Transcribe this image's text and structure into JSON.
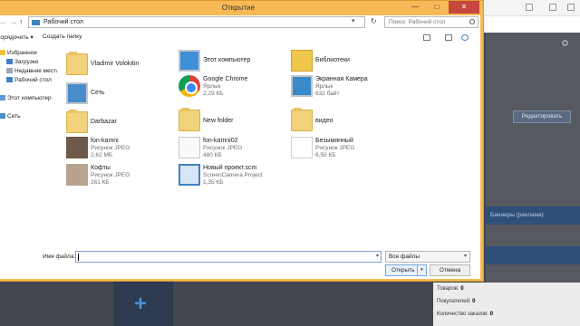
{
  "dialog": {
    "title": "Открытие",
    "close_glyph": "✕",
    "min_glyph": "—",
    "max_glyph": "□"
  },
  "address": {
    "path": "Рабочий стол",
    "search_placeholder": "Поиск: Рабочий стол",
    "refresh_glyph": "↻",
    "back_glyph": "←",
    "forward_glyph": "→",
    "up_glyph": "↑",
    "chevron_glyph": "▾"
  },
  "toolbar": {
    "organize": "Упорядочить ▾",
    "new_folder": "Создать папку"
  },
  "sidebar": {
    "items": [
      {
        "label": "Избранное",
        "icon": "star-icon"
      },
      {
        "label": "Загрузки",
        "icon": "downloads-icon"
      },
      {
        "label": "Недавние места",
        "icon": "recent-icon"
      },
      {
        "label": "Рабочий стол",
        "icon": "desktop-icon"
      },
      {
        "label": "Этот компьютер",
        "icon": "computer-icon"
      },
      {
        "label": "Сеть",
        "icon": "network-icon"
      }
    ]
  },
  "files": [
    {
      "name": "Vladimir Volokitin",
      "sub1": "",
      "sub2": "",
      "icon": "folder-icon"
    },
    {
      "name": "Сеть",
      "sub1": "",
      "sub2": "",
      "icon": "network-icon"
    },
    {
      "name": "Darbazar",
      "sub1": "",
      "sub2": "",
      "icon": "folder-icon"
    },
    {
      "name": "fon-kamni",
      "sub1": "Рисунок JPEG",
      "sub2": "2,62 МБ",
      "icon": "image-icon"
    },
    {
      "name": "Кофты",
      "sub1": "Рисунок JPEG",
      "sub2": "261 КБ",
      "icon": "image-icon"
    },
    {
      "name": "Этот компьютер",
      "sub1": "",
      "sub2": "",
      "icon": "computer-icon"
    },
    {
      "name": "Google Chrome",
      "sub1": "Ярлык",
      "sub2": "2,29 КБ",
      "icon": "chrome-icon"
    },
    {
      "name": "New folder",
      "sub1": "",
      "sub2": "",
      "icon": "folder-icon"
    },
    {
      "name": "fon-kamni02",
      "sub1": "Рисунок JPEG",
      "sub2": "480 КБ",
      "icon": "image-icon"
    },
    {
      "name": "Новый проект.scm",
      "sub1": "ScreenCamera Project",
      "sub2": "1,35 КБ",
      "icon": "project-icon"
    },
    {
      "name": "Библиотеки",
      "sub1": "",
      "sub2": "",
      "icon": "library-icon"
    },
    {
      "name": "Экранная Камера",
      "sub1": "Ярлык",
      "sub2": "632 байт",
      "icon": "app-icon"
    },
    {
      "name": "видео",
      "sub1": "",
      "sub2": "",
      "icon": "folder-icon"
    },
    {
      "name": "Безымянный",
      "sub1": "Рисунок JPEG",
      "sub2": "6,50 КБ",
      "icon": "image-icon"
    }
  ],
  "bottom": {
    "filename_label": "Имя файла:",
    "filename_value": "",
    "filetype": "Все файлы",
    "open_label": "Открыть",
    "cancel_label": "Отмена"
  },
  "background": {
    "edit_button": "Редактировать",
    "blue_bar": "Баннеры (реклама)",
    "stats": [
      {
        "label": "Товаров:",
        "value": "0"
      },
      {
        "label": "Покупателей:",
        "value": "0"
      },
      {
        "label": "Количество заказов:",
        "value": "0"
      }
    ],
    "plus_glyph": "+"
  },
  "colors": {
    "dialog_frame": "#f7b955",
    "close_button": "#c7463b",
    "accent_blue": "#3f83c5",
    "bg_blue_bar": "#2e4f78"
  }
}
